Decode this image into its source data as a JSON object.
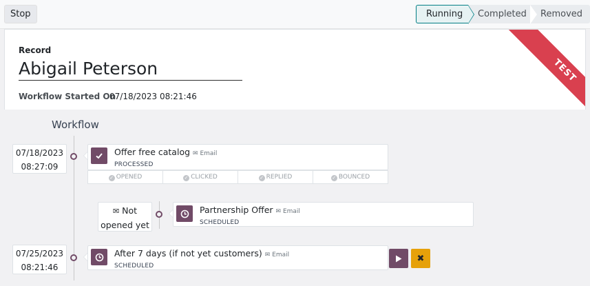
{
  "toolbar": {
    "stop_label": "Stop"
  },
  "stages": [
    "Running",
    "Completed",
    "Removed"
  ],
  "record": {
    "label": "Record",
    "name": "Abigail Peterson",
    "started_label": "Workflow Started On",
    "started_value": "07/18/2023 08:21:46",
    "ribbon": "TEST"
  },
  "workflow": {
    "title": "Workflow",
    "activities": [
      {
        "date": "07/18/2023",
        "time": "08:27:09",
        "title": "Offer free catalog",
        "channel": "Email",
        "status": "PROCESSED",
        "stats": [
          "OPENED",
          "CLICKED",
          "REPLIED",
          "BOUNCED"
        ]
      },
      {
        "trigger_line1": "Not",
        "trigger_line2": "opened yet",
        "title": "Partnership Offer",
        "channel": "Email",
        "status": "SCHEDULED"
      },
      {
        "date": "07/25/2023",
        "time": "08:21:46",
        "title": "After 7 days (if not yet customers)",
        "channel": "Email",
        "status": "SCHEDULED"
      }
    ]
  },
  "colors": {
    "accent": "#714b67",
    "ribbon": "#d9404f",
    "cancel": "#e6a10a",
    "stage_active": "#017e84"
  },
  "icons": {
    "processed": "check-icon",
    "scheduled": "clock-icon",
    "channel": "envelope-icon",
    "trigger": "envelope-open-icon",
    "run": "play-icon",
    "cancel": "times-icon"
  }
}
